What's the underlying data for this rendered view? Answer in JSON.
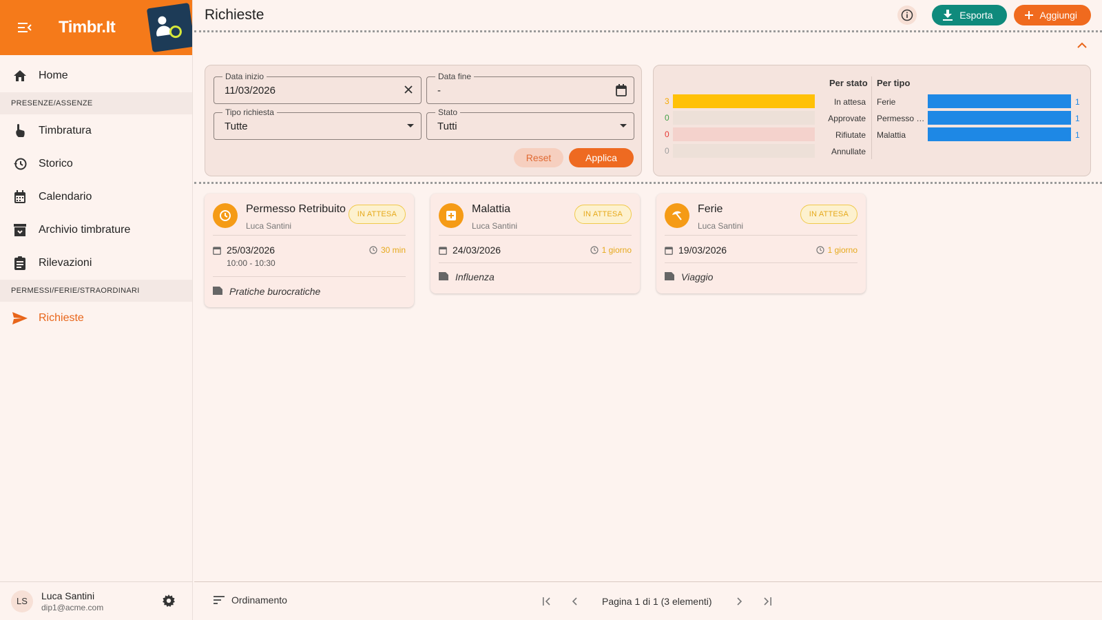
{
  "app": {
    "name": "Timbr.It"
  },
  "sidebar": {
    "home": "Home",
    "section1": "PRESENZE/ASSENZE",
    "items1": [
      {
        "label": "Timbratura",
        "icon": "touch-icon"
      },
      {
        "label": "Storico",
        "icon": "history-icon"
      },
      {
        "label": "Calendario",
        "icon": "calendar-icon"
      },
      {
        "label": "Archivio timbrature",
        "icon": "archive-icon"
      },
      {
        "label": "Rilevazioni",
        "icon": "clipboard-icon"
      }
    ],
    "section2": "PERMESSI/FERIE/STRAORDINARI",
    "richieste": "Richieste"
  },
  "user": {
    "initials": "LS",
    "name": "Luca Santini",
    "email": "dip1@acme.com"
  },
  "header": {
    "title": "Richieste",
    "export_label": "Esporta",
    "add_label": "Aggiungi"
  },
  "filters": {
    "start_label": "Data inizio",
    "start_value": "11/03/2026",
    "end_label": "Data fine",
    "end_value": "-",
    "type_label": "Tipo richiesta",
    "type_value": "Tutte",
    "state_label": "Stato",
    "state_value": "Tutti",
    "reset_label": "Reset",
    "apply_label": "Applica"
  },
  "stats": {
    "by_state_title": "Per stato",
    "by_type_title": "Per tipo",
    "by_state": [
      {
        "label": "In attesa",
        "count": "3",
        "fraction": 1.0,
        "color": "#ffc107",
        "track": "#f5e4de",
        "countColor": "#f5a800"
      },
      {
        "label": "Approvate",
        "count": "0",
        "fraction": 0,
        "color": "#4caf50",
        "track": "#ede0d8",
        "countColor": "#43a047"
      },
      {
        "label": "Rifiutate",
        "count": "0",
        "fraction": 0,
        "color": "#e53935",
        "track": "#f4d2cc",
        "countColor": "#e53935"
      },
      {
        "label": "Annullate",
        "count": "0",
        "fraction": 0,
        "color": "#9e9e9e",
        "track": "#ede0d8",
        "countColor": "#9e9e9e"
      }
    ],
    "by_type": [
      {
        "label": "Ferie",
        "count": "1",
        "fraction": 1.0
      },
      {
        "label": "Permesso Retribuito",
        "count": "1",
        "fraction": 1.0
      },
      {
        "label": "Malattia",
        "count": "1",
        "fraction": 1.0
      }
    ]
  },
  "cards": [
    {
      "title": "Permesso Retribuito",
      "user": "Luca Santini",
      "status": "IN ATTESA",
      "icon": "clock-icon",
      "date": "25/03/2026",
      "time": "10:00 - 10:30",
      "duration": "30 min",
      "note": "Pratiche burocratiche"
    },
    {
      "title": "Malattia",
      "user": "Luca Santini",
      "status": "IN ATTESA",
      "icon": "medical-icon",
      "date": "24/03/2026",
      "time": "",
      "duration": "1 giorno",
      "note": "Influenza"
    },
    {
      "title": "Ferie",
      "user": "Luca Santini",
      "status": "IN ATTESA",
      "icon": "beach-umbrella-icon",
      "date": "19/03/2026",
      "time": "",
      "duration": "1 giorno",
      "note": "Viaggio"
    }
  ],
  "footer": {
    "sort_label": "Ordinamento",
    "page_text": "Pagina 1 di 1 (3 elementi)"
  }
}
